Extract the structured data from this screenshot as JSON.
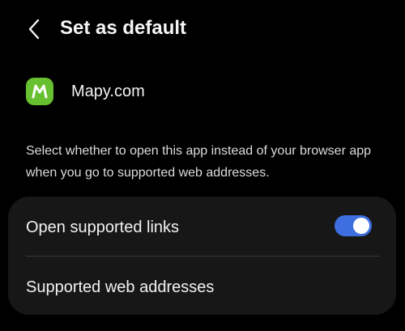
{
  "header": {
    "title": "Set as default",
    "back_icon": "chevron-left-icon"
  },
  "app": {
    "name": "Mapy.com",
    "icon": "mapy-app-icon",
    "icon_letter": "M",
    "icon_color": "#66c02f"
  },
  "description": "Select whether to open this app instead of your browser app when you go to supported web addresses.",
  "settings": {
    "open_supported_links": {
      "label": "Open supported links",
      "enabled": true,
      "toggle_color": "#3e6fe0"
    },
    "supported_web_addresses": {
      "label": "Supported web addresses"
    }
  }
}
